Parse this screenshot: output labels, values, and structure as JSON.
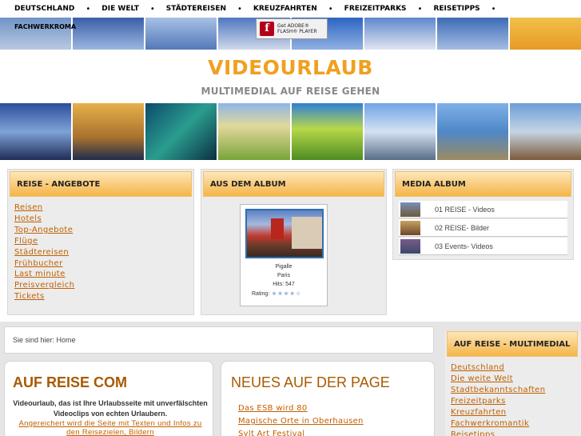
{
  "nav": {
    "items": [
      "DEUTSCHLAND",
      "DIE WELT",
      "STÄDTEREISEN",
      "KREUZFAHRTEN",
      "FREIZEITPARKS",
      "REISETIPPS"
    ],
    "separator": "•",
    "extra_item": "FACHWERKROMA",
    "flash_badge": {
      "line1": "Get ADOBE®",
      "line2": "FLASH® PLAYER",
      "logo": "f"
    }
  },
  "header": {
    "title": "VIDEOURLAUB",
    "subtitle": "MULTIMEDIAL AUF REISE GEHEN"
  },
  "angebote": {
    "heading": "REISE - ANGEBOTE",
    "links": [
      "Reisen",
      "Hotels",
      "Top-Angebote",
      "Flüge",
      "Städtereisen",
      "Frühbucher",
      "Last minute",
      "Preisvergleich",
      "Tickets"
    ]
  },
  "album": {
    "heading": "AUS DEM ALBUM",
    "caption_title": "Pigalle",
    "caption_location": "Paris",
    "hits": "Hits: 547",
    "rating_label": "Rating:",
    "rating_value": 4,
    "rating_max": 5
  },
  "media": {
    "heading": "MEDIA ALBUM",
    "items": [
      "01 REISE - Videos",
      "02 REISE- Bilder",
      "03 Events- Videos"
    ]
  },
  "breadcrumb": {
    "text": "Sie sind hier: Home"
  },
  "auf_reise": {
    "title": "AUF REISE COM",
    "text": "Videourlaub, das ist Ihre Urlaubsseite mit unverfälschten Videoclips von echten Urlaubern.",
    "link_text": "Angereichert wird die Seite mit Texten und Infos zu den Reisezielen, Bildern"
  },
  "neues": {
    "title": "NEUES AUF DER PAGE",
    "links": [
      "Das ESB wird 80",
      "Magische Orte in Oberhausen",
      "Sylt Art Festival"
    ]
  },
  "multimedial": {
    "heading": "AUF REISE - MULTIMEDIAL",
    "links": [
      "Deutschland",
      "Die weite Welt",
      "Stadtbekanntschaften",
      "Freizeitparks",
      "Kreuzfahrten",
      "Fachwerkromantik",
      "Reisetipps"
    ]
  },
  "colors": {
    "accent": "#f0a020",
    "link": "#c06000",
    "heading_brown": "#a85a00",
    "box_header": "#f5b548"
  }
}
